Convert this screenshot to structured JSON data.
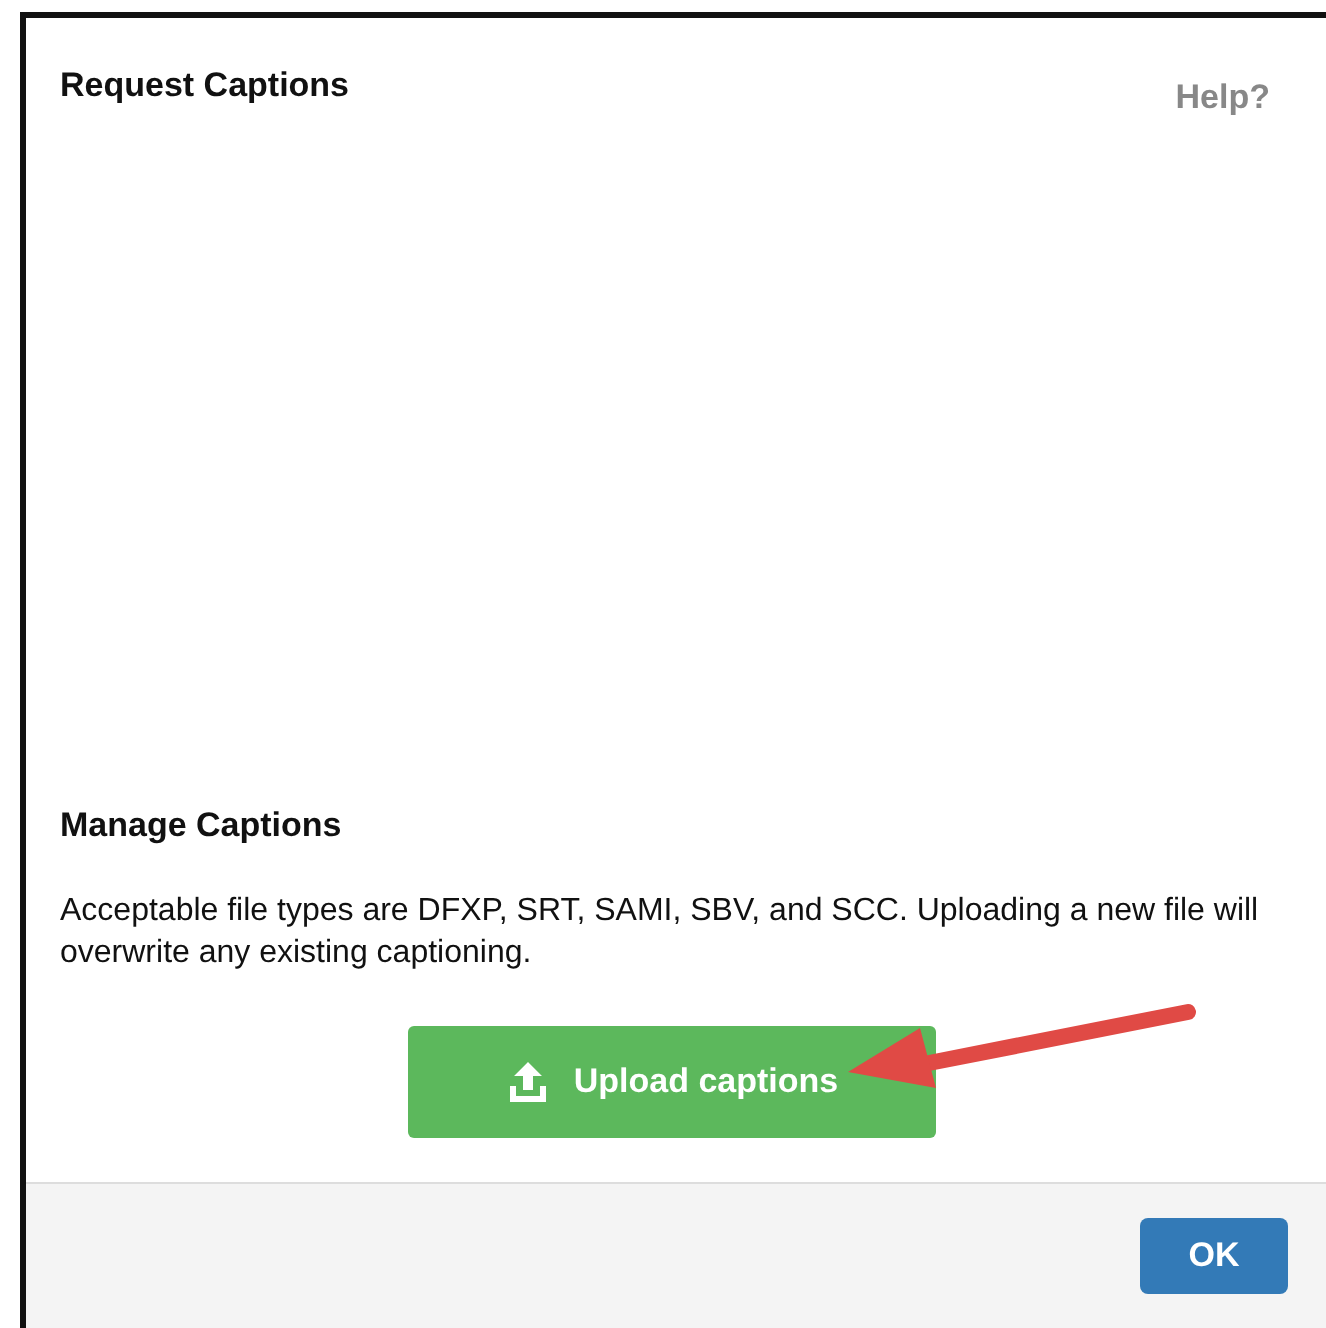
{
  "dialog": {
    "title": "Request Captions",
    "help_link": "Help?"
  },
  "manage": {
    "heading": "Manage Captions",
    "description": "Acceptable file types are DFXP, SRT, SAMI, SBV, and SCC. Uploading a new file will overwrite any existing captioning.",
    "upload_button": "Upload captions"
  },
  "footer": {
    "ok_button": "OK"
  }
}
